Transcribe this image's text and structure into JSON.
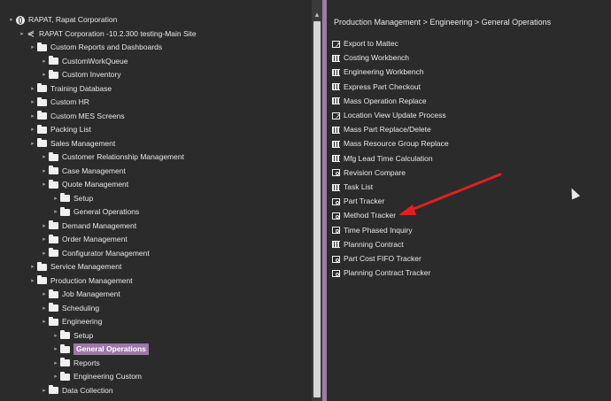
{
  "tree": {
    "items": [
      {
        "label": "RAPAT, Rapat Corporation",
        "icon": "globe-icon",
        "depth": 0
      },
      {
        "label": "RAPAT Corporation -10.2.300 testing-Main Site",
        "icon": "share-icon",
        "depth": 1
      },
      {
        "label": "Custom Reports and Dashboards",
        "icon": "folder-icon",
        "depth": 2
      },
      {
        "label": "CustomWorkQueue",
        "icon": "folder-icon",
        "depth": 3
      },
      {
        "label": "Custom Inventory",
        "icon": "folder-icon",
        "depth": 3
      },
      {
        "label": "Training Database",
        "icon": "folder-icon",
        "depth": 2
      },
      {
        "label": "Custom HR",
        "icon": "folder-icon",
        "depth": 2
      },
      {
        "label": "Custom MES Screens",
        "icon": "folder-icon",
        "depth": 2
      },
      {
        "label": "Packing List",
        "icon": "folder-icon",
        "depth": 2
      },
      {
        "label": "Sales Management",
        "icon": "folder-icon",
        "depth": 2
      },
      {
        "label": "Customer Relationship Management",
        "icon": "folder-icon",
        "depth": 3
      },
      {
        "label": "Case Management",
        "icon": "folder-icon",
        "depth": 3
      },
      {
        "label": "Quote Management",
        "icon": "folder-icon",
        "depth": 3
      },
      {
        "label": "Setup",
        "icon": "folder-icon",
        "depth": 4
      },
      {
        "label": "General Operations",
        "icon": "folder-icon",
        "depth": 4
      },
      {
        "label": "Demand Management",
        "icon": "folder-icon",
        "depth": 3
      },
      {
        "label": "Order Management",
        "icon": "folder-icon",
        "depth": 3
      },
      {
        "label": "Configurator Management",
        "icon": "folder-icon",
        "depth": 3
      },
      {
        "label": "Service Management",
        "icon": "folder-icon",
        "depth": 2
      },
      {
        "label": "Production Management",
        "icon": "folder-icon",
        "depth": 2
      },
      {
        "label": "Job Management",
        "icon": "folder-icon",
        "depth": 3
      },
      {
        "label": "Scheduling",
        "icon": "folder-icon",
        "depth": 3
      },
      {
        "label": "Engineering",
        "icon": "folder-icon",
        "depth": 3
      },
      {
        "label": "Setup",
        "icon": "folder-icon",
        "depth": 4
      },
      {
        "label": "General Operations",
        "icon": "folder-icon",
        "depth": 4,
        "selected": true
      },
      {
        "label": "Reports",
        "icon": "folder-icon",
        "depth": 4
      },
      {
        "label": "Engineering Custom",
        "icon": "folder-icon",
        "depth": 4
      },
      {
        "label": "Data Collection",
        "icon": "folder-icon",
        "depth": 3
      }
    ]
  },
  "breadcrumb": "Production Management > Engineering > General Operations",
  "operations": [
    {
      "label": "Export to Mattec",
      "icon": "export-icon"
    },
    {
      "label": "Costing Workbench",
      "icon": "grid-icon"
    },
    {
      "label": "Engineering Workbench",
      "icon": "grid-icon"
    },
    {
      "label": "Express Part Checkout",
      "icon": "grid-icon"
    },
    {
      "label": "Mass Operation Replace",
      "icon": "grid-icon"
    },
    {
      "label": "Location View Update Process",
      "icon": "export-icon"
    },
    {
      "label": "Mass Part Replace/Delete",
      "icon": "grid-icon"
    },
    {
      "label": "Mass Resource Group Replace",
      "icon": "grid-icon"
    },
    {
      "label": "Mfg Lead Time Calculation",
      "icon": "grid-icon"
    },
    {
      "label": "Revision Compare",
      "icon": "search-icon"
    },
    {
      "label": "Task List",
      "icon": "grid-icon"
    },
    {
      "label": "Part Tracker",
      "icon": "search-icon"
    },
    {
      "label": "Method Tracker",
      "icon": "search-icon"
    },
    {
      "label": "Time Phased Inquiry",
      "icon": "search-icon"
    },
    {
      "label": "Planning Contract",
      "icon": "grid-icon"
    },
    {
      "label": "Part Cost FIFO Tracker",
      "icon": "search-icon"
    },
    {
      "label": "Planning Contract Tracker",
      "icon": "search-icon"
    }
  ],
  "colors": {
    "accent": "#9b78a6",
    "annotation_arrow": "#e02020"
  }
}
